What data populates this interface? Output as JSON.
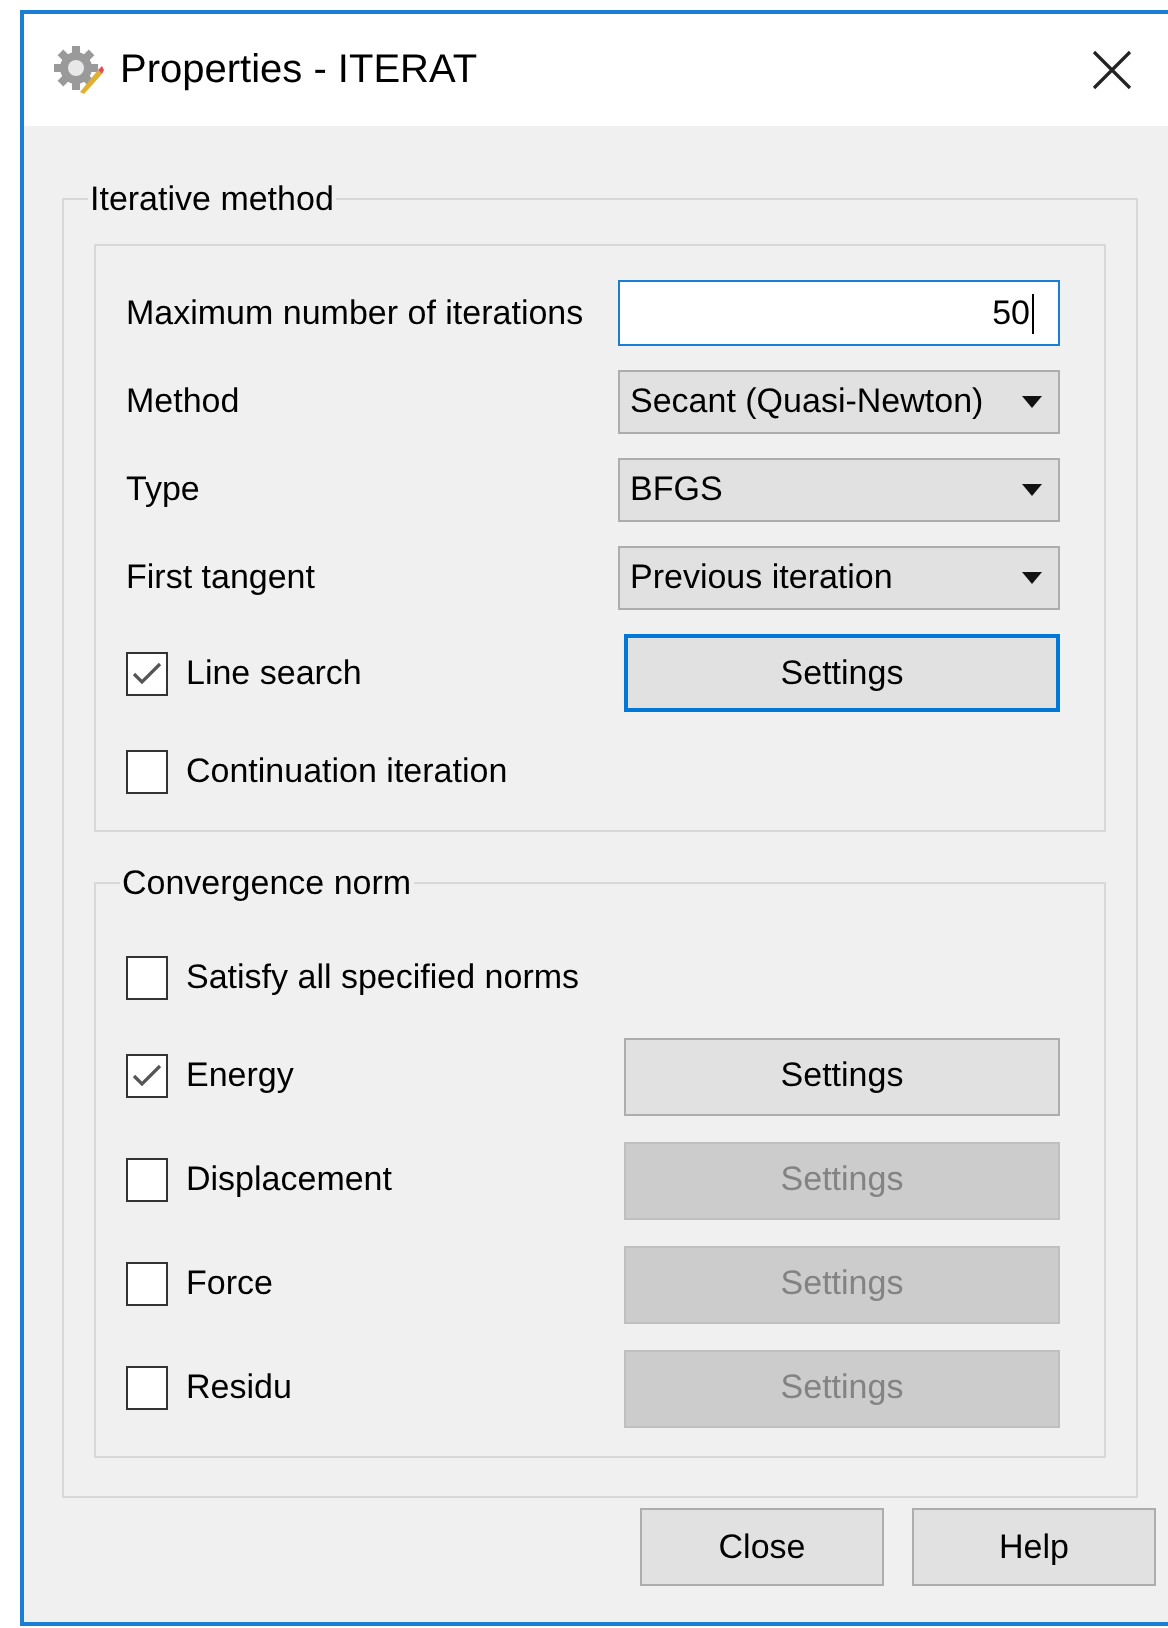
{
  "window": {
    "title": "Properties - ITERAT"
  },
  "iterative_method": {
    "legend": "Iterative method",
    "rows": [
      {
        "kind": "input",
        "label": "Maximum number of iterations",
        "value": "50",
        "focused": true
      },
      {
        "kind": "dropdown",
        "label": "Method",
        "value": "Secant (Quasi-Newton)"
      },
      {
        "kind": "dropdown",
        "label": "Type",
        "value": "BFGS"
      },
      {
        "kind": "dropdown",
        "label": "First tangent",
        "value": "Previous iteration"
      },
      {
        "kind": "checkbox",
        "label": "Line search",
        "checked": true,
        "button": {
          "label": "Settings",
          "focused": true,
          "disabled": false
        }
      },
      {
        "kind": "checkbox",
        "label": "Continuation iteration",
        "checked": false
      }
    ]
  },
  "convergence_norm": {
    "legend": "Convergence norm",
    "rows": [
      {
        "kind": "checkbox",
        "label": "Satisfy all specified norms",
        "checked": false
      },
      {
        "kind": "checkbox",
        "label": "Energy",
        "checked": true,
        "button": {
          "label": "Settings",
          "focused": false,
          "disabled": false
        }
      },
      {
        "kind": "checkbox",
        "label": "Displacement",
        "checked": false,
        "button": {
          "label": "Settings",
          "focused": false,
          "disabled": true
        }
      },
      {
        "kind": "checkbox",
        "label": "Force",
        "checked": false,
        "button": {
          "label": "Settings",
          "focused": false,
          "disabled": true
        }
      },
      {
        "kind": "checkbox",
        "label": "Residu",
        "checked": false,
        "button": {
          "label": "Settings",
          "focused": false,
          "disabled": true
        }
      }
    ]
  },
  "buttons": [
    "Close",
    "Help"
  ]
}
